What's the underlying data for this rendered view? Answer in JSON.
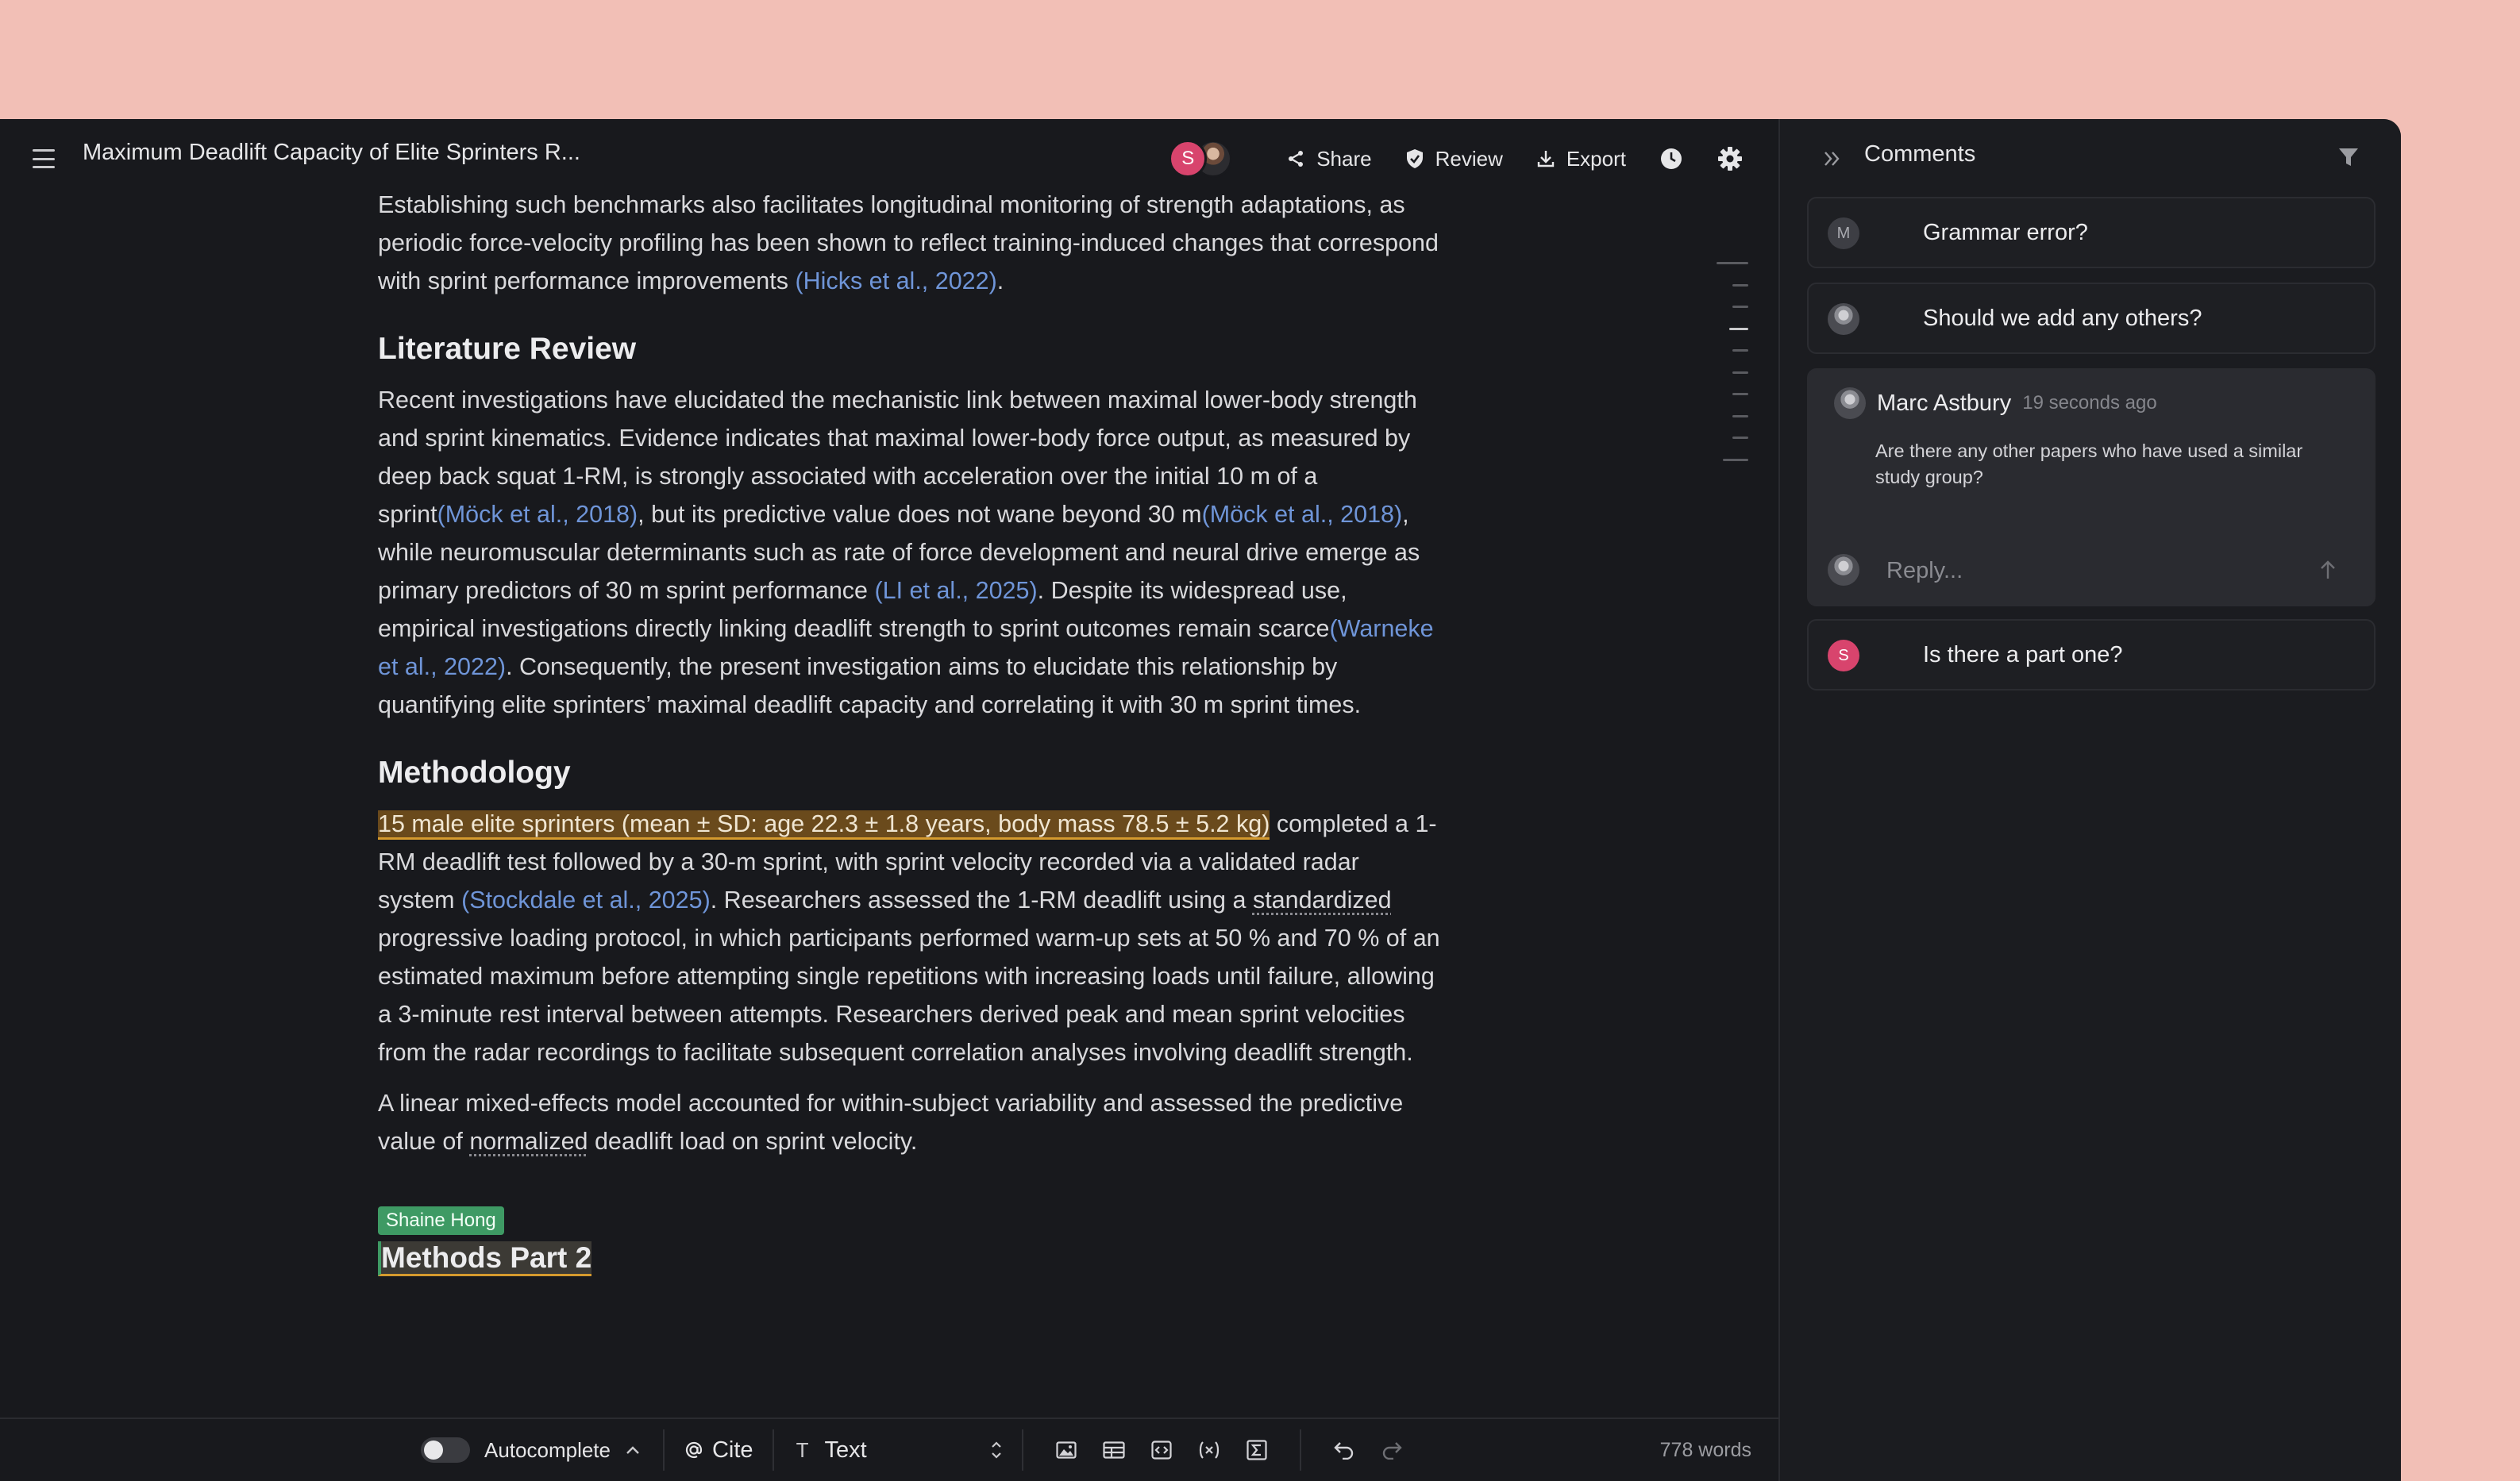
{
  "colors": {
    "page_background": "#f2bfb6",
    "app_background": "#18191d",
    "link": "#6f95d8",
    "highlight": "#6a4a1c",
    "collaborator": "#3e9a64",
    "avatar_s": "#d8446d"
  },
  "topbar": {
    "menu_icon": "hamburger-menu-icon",
    "title": "Maximum Deadlift Capacity of Elite Sprinters R...",
    "avatar_initial": "S",
    "share_label": "Share",
    "review_label": "Review",
    "export_label": "Export",
    "history_icon": "clock-icon",
    "settings_icon": "gear-icon"
  },
  "document": {
    "intro": {
      "text": "Establishing such benchmarks also facilitates longitudinal monitoring of strength adaptations, as periodic force-velocity profiling has been shown to reflect training-induced changes that correspond with sprint performance improvements ",
      "cite1": "(Hicks et al., 2022)",
      "end": "."
    },
    "lit_review": {
      "heading": "Literature Review",
      "t1": "Recent investigations have elucidated the mechanistic link between maximal lower-body strength and sprint kinematics. Evidence indicates that maximal lower-body force output, as measured by deep back squat 1-RM, is strongly associated with acceleration over the initial 10 m of a sprint",
      "c1": "(Möck et al., 2018)",
      "t2": ", but its predictive value does not wane beyond 30 m",
      "c2": "(Möck et al., 2018)",
      "t3": ", while neuromuscular determinants such as rate of force development and neural drive emerge as primary predictors of 30 m sprint performance ",
      "c3": "(LI et al., 2025)",
      "t4": ". Despite its widespread use, empirical investigations directly linking deadlift strength to sprint outcomes remain scarce",
      "c4": "(Warneke et al., 2022)",
      "t5": ". Consequently, the present investigation aims to elucidate this relationship by quantifying elite sprinters’ maximal deadlift capacity and correlating it with 30 m sprint times."
    },
    "methodology": {
      "heading": "Methodology",
      "highlight": "15 male elite sprinters (mean ± SD: age 22.3 ± 1.8 years, body mass 78.5 ± 5.2 kg)",
      "t1": " completed a 1-RM deadlift test followed by a 30-m sprint, with sprint velocity recorded via a validated radar system ",
      "c1": "(Stockdale et al., 2025)",
      "t2": ". Researchers assessed the 1-RM deadlift using a ",
      "spell1": "standardized",
      "t3": " progressive loading protocol, in which participants performed warm-up sets at 50 % and 70 % of an estimated maximum before attempting single repetitions with increasing loads until failure, allowing a 3-minute rest interval between attempts. Researchers derived peak and mean sprint velocities from the radar recordings to facilitate subsequent correlation analyses involving deadlift strength.",
      "p2_t1": "A linear mixed-effects model accounted for within-subject variability and assessed the predictive value of ",
      "p2_spell": "normalized",
      "p2_t2": " deadlift load on sprint velocity."
    },
    "collaborator": {
      "name": "Shaine Hong",
      "heading": "Methods Part 2"
    }
  },
  "bottom_bar": {
    "autocomplete_label": "Autocomplete",
    "autocomplete_on": false,
    "cite_label": "Cite",
    "text_style_icon": "T",
    "text_style_label": "Text",
    "tools": [
      "image-icon",
      "table-icon",
      "code-block-icon",
      "variable-icon",
      "formula-icon"
    ],
    "undo_icon": "undo-icon",
    "redo_icon": "redo-icon",
    "word_count": "778 words"
  },
  "comments": {
    "title": "Comments",
    "items": [
      {
        "avatar": "M",
        "text": "Grammar error?"
      },
      {
        "avatar": "",
        "text": "Should we add any others?"
      }
    ],
    "thread": {
      "author": "Marc Astbury",
      "time": "19 seconds ago",
      "body": "Are there any other papers who have used a similar study group?",
      "reply_placeholder": "Reply..."
    },
    "last": {
      "avatar": "S",
      "text": "Is there a part one?"
    }
  }
}
